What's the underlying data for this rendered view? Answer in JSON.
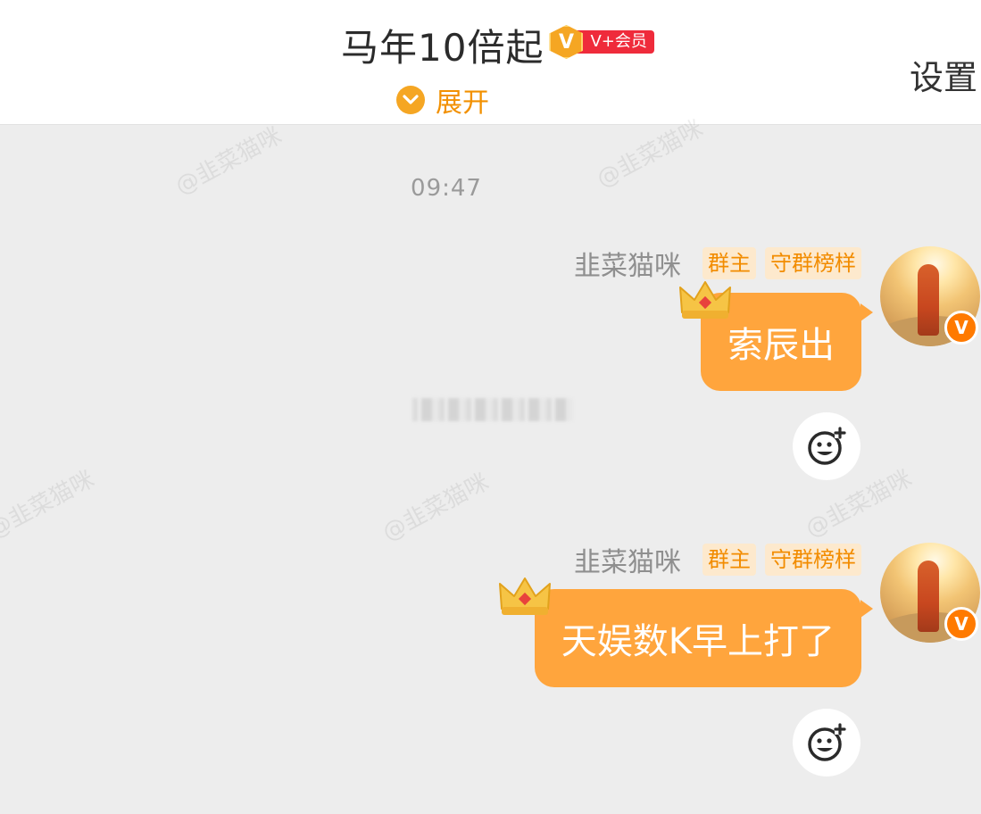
{
  "header": {
    "group_title": "马年10倍起",
    "vip_badge_letter": "V",
    "vip_badge_label": "V+会员",
    "expand_label": "展开",
    "settings_label": "设置"
  },
  "watermark": "@韭菜猫咪",
  "timestamp": "09:47",
  "messages": [
    {
      "sender": "韭菜猫咪",
      "tags": [
        "群主",
        "守群榜样"
      ],
      "text": "索辰出",
      "verified_letter": "V"
    },
    {
      "sender": "韭菜猫咪",
      "tags": [
        "群主",
        "守群榜样"
      ],
      "text": "天娱数K早上打了",
      "verified_letter": "V"
    }
  ],
  "colors": {
    "bubble": "#ffa53d",
    "accent": "#f29000",
    "tag_bg": "#fde9cd",
    "chat_bg": "#ededed"
  },
  "icons": [
    "chevron-down-icon",
    "crown-icon",
    "add-reaction-icon",
    "verified-icon"
  ]
}
